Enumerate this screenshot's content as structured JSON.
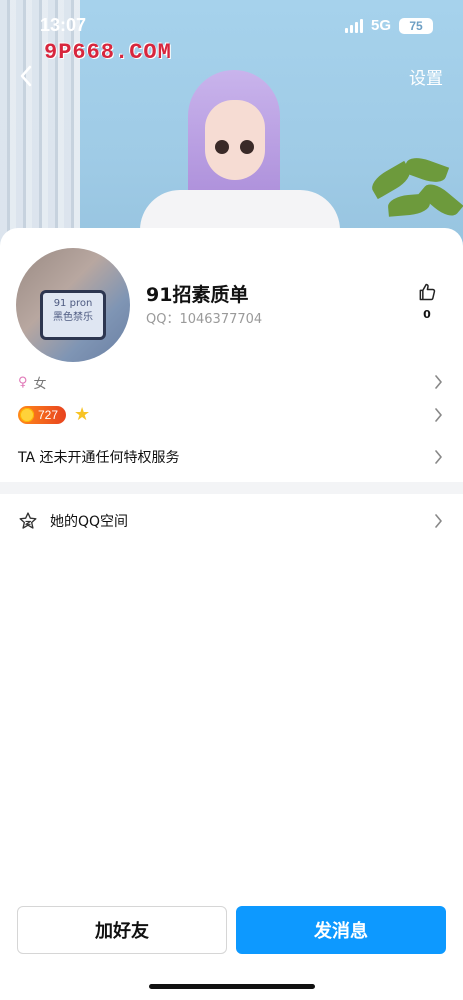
{
  "status_bar": {
    "time": "13:07",
    "network": "5G",
    "battery": "75"
  },
  "watermark_text": "9P668.COM",
  "header": {
    "settings_label": "设置"
  },
  "profile": {
    "nickname": "91招素质单",
    "qq_label": "QQ：1046377704",
    "likes": "0",
    "avatar_screen_text": "91 pron\n黑色禁乐"
  },
  "info": {
    "gender": "女",
    "level": "727",
    "privilege_text": "TA 还未开通任何特权服务",
    "qzone_label": "她的QQ空间"
  },
  "actions": {
    "add_friend": "加好友",
    "send_message": "发消息"
  },
  "colors": {
    "primary_button": "#0d99ff",
    "level_badge": "#e8431f",
    "gender_symbol": "#e079b8"
  }
}
